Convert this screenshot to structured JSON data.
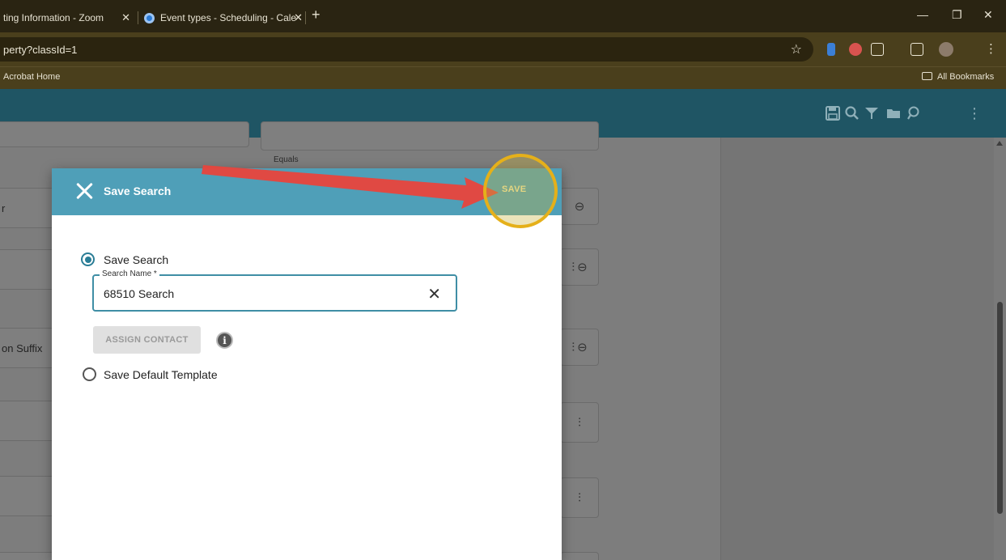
{
  "browser": {
    "tabs": [
      {
        "label": "ting Information - Zoom"
      },
      {
        "label": "Event types - Scheduling - Cale"
      }
    ],
    "url": "perty?classId=1",
    "bookmarks": {
      "left": "Acrobat Home",
      "right": "All Bookmarks"
    }
  },
  "background": {
    "equals_label": "Equals",
    "row_labels": [
      "r",
      "on Suffix"
    ]
  },
  "dialog": {
    "title": "Save Search",
    "save_label": "SAVE",
    "option_save_search": "Save Search",
    "field_label": "Search Name *",
    "field_value": "68510 Search",
    "assign_contact": "ASSIGN CONTACT",
    "option_default_template": "Save Default Template"
  },
  "colors": {
    "header": "#1f5564",
    "dialog_header": "#4f9fb8",
    "accent": "#2a7d96",
    "annotation_arrow": "#e8453c",
    "annotation_circle": "#e5b01a"
  }
}
